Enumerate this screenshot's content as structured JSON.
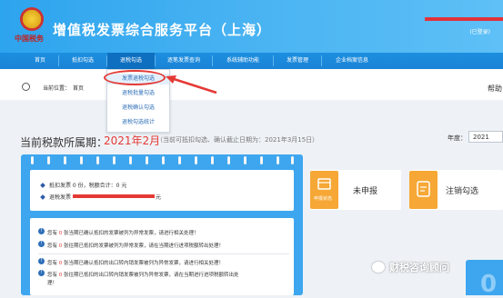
{
  "header": {
    "emblem_text": "中国税务",
    "app_title": "增值税发票综合服务平台（上海）",
    "user_sub": "(已登录)"
  },
  "nav": {
    "items": [
      "首页",
      "抵扣勾选",
      "退税勾选",
      "代办退税勾选",
      "逐笔发票查询",
      "系统辅助功能",
      "发票管理",
      "企业档案信息"
    ]
  },
  "dropdown": {
    "items": [
      "发票退税勾选",
      "退税批量勾选",
      "退税确认勾选",
      "退税勾选统计"
    ]
  },
  "breadcrumb": {
    "label": "当前位置：",
    "current": "首页",
    "help": "帮助"
  },
  "period": {
    "title": "当前税款所属期：",
    "value": "2021年2月",
    "note": "（当前可抵扣勾选、确认截止日期为：2021年3月15日）",
    "year_label": "年度：",
    "year_value": "2021"
  },
  "summary": {
    "line1": "抵扣发票 0 份，税额合计：0 元",
    "line2_prefix": "退税发票",
    "line2_suffix": "元"
  },
  "notices": [
    {
      "prefix": "您有",
      "count": "0",
      "text": "张当期已确认抵扣的发票被列为异常发票，请进行相关处理！"
    },
    {
      "prefix": "您有",
      "count": "0",
      "text": "张往期已抵扣的发票被列为异常发票，请在当期进行进项税额转出处理！"
    },
    {
      "prefix": "您有",
      "count": "0",
      "text": "张当期已确认抵扣的出口转内销发票被列为异常发票，请进行相关处理！"
    },
    {
      "prefix": "您有",
      "count": "0",
      "text": "张往期已抵扣的出口转内销发票被列为异常发票，请在当期进行进项税额转出处"
    },
    {
      "prefix": "",
      "count": "",
      "text": "理！"
    }
  ],
  "tiles": {
    "declare_sub": "申报状态",
    "declare_label": "未申报",
    "cancel_label": "注销勾选"
  },
  "watermark": "财税咨询顾问",
  "colors": {
    "header_blue": "#2da4ee",
    "nav_blue": "#1a83d6",
    "accent_red": "#e53935",
    "tile_orange": "#f6a735"
  }
}
